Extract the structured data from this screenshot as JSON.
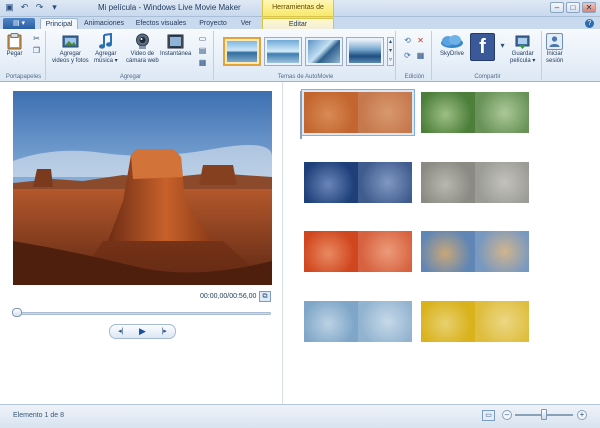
{
  "window": {
    "title": "Mi película - Windows Live Movie Maker",
    "context_tool_title": "Herramientas de video",
    "controls": {
      "minimize": "–",
      "maximize": "□",
      "close": "✕"
    }
  },
  "quick_access": {
    "app_menu_label": "▾"
  },
  "tabs": [
    {
      "label": "Principal",
      "active": true
    },
    {
      "label": "Animaciones"
    },
    {
      "label": "Efectos visuales"
    },
    {
      "label": "Proyecto"
    },
    {
      "label": "Ver"
    },
    {
      "label": "Editar",
      "contextual": true
    }
  ],
  "help_label": "?",
  "ribbon": {
    "clipboard": {
      "label": "Portapapeles",
      "paste": "Pegar"
    },
    "add": {
      "label": "Agregar",
      "add_videos_photos": [
        "Agregar",
        "videos y fotos"
      ],
      "add_music": [
        "Agregar",
        "música ▾"
      ],
      "webcam_video": [
        "Video de",
        "cámara web"
      ],
      "snapshot": "Instantánea"
    },
    "themes": {
      "label": "Temas de AutoMovie"
    },
    "edit": {
      "label": "Edición"
    },
    "share": {
      "label": "Compartir",
      "skydrive": "SkyDrive",
      "save_movie": [
        "Guardar",
        "película ▾"
      ],
      "sign_in": [
        "Iniciar",
        "sesión"
      ]
    }
  },
  "preview": {
    "timecode": "00:00,00/00:56,00",
    "progress": 0
  },
  "storyboard": {
    "clips": [
      {
        "name": "desert",
        "colors": [
          "#c2652e",
          "#d98a55"
        ],
        "selected": true
      },
      {
        "name": "flower",
        "colors": [
          "#4d7f3a",
          "#9dbf86"
        ]
      },
      {
        "name": "jellyfish",
        "colors": [
          "#1e3f7a",
          "#6a86b8"
        ]
      },
      {
        "name": "koala",
        "colors": [
          "#8b8b84",
          "#b8b8b0"
        ]
      },
      {
        "name": "chrysanthemum",
        "colors": [
          "#d0461e",
          "#e88a62"
        ]
      },
      {
        "name": "lighthouse",
        "colors": [
          "#5f86b5",
          "#c8a77a"
        ]
      },
      {
        "name": "penguins",
        "colors": [
          "#7fa6c8",
          "#bcd2e4"
        ]
      },
      {
        "name": "tulips",
        "colors": [
          "#d9b21c",
          "#e8d06e"
        ]
      }
    ]
  },
  "status": {
    "element_text": "Elemento 1 de 8",
    "zoom_level": 0.5
  },
  "colors": {
    "accent": "#2b6cb0",
    "ribbon_bg": "#dde8f5",
    "selection": "#e0a43a"
  }
}
